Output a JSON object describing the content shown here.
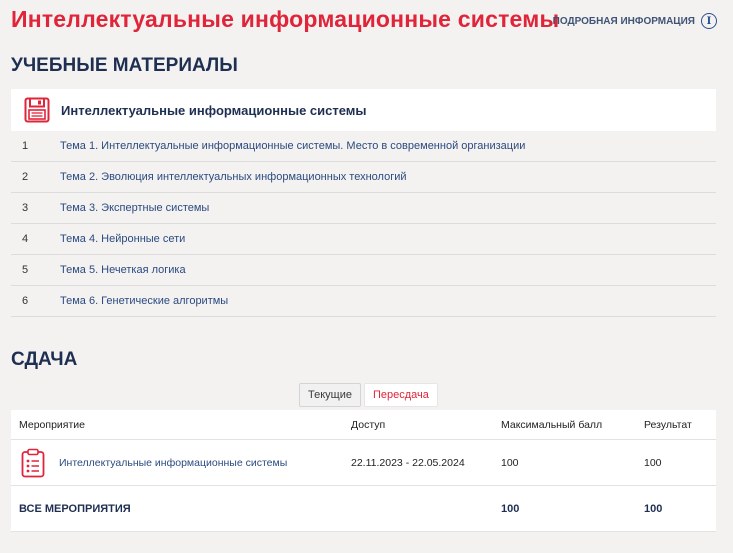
{
  "header": {
    "title": "Интеллектуальные информационные системы",
    "info_label": "ПОДРОБНАЯ ИНФОРМАЦИЯ",
    "info_glyph": "i"
  },
  "materials": {
    "section_title": "УЧЕБНЫЕ МАТЕРИАЛЫ",
    "card_title": "Интеллектуальные информационные системы",
    "items": [
      {
        "num": "1",
        "label": "Тема 1. Интеллектуальные информационные системы. Место в современной организации"
      },
      {
        "num": "2",
        "label": "Тема 2. Эволюция интеллектуальных информационных технологий"
      },
      {
        "num": "3",
        "label": "Тема 3. Экспертные системы"
      },
      {
        "num": "4",
        "label": "Тема 4. Нейронные сети"
      },
      {
        "num": "5",
        "label": "Тема 5. Нечеткая логика"
      },
      {
        "num": "6",
        "label": "Тема 6. Генетические алгоритмы"
      }
    ]
  },
  "exam": {
    "section_title": "СДАЧА",
    "tabs": [
      {
        "label": "Текущие"
      },
      {
        "label": "Пересдача"
      }
    ],
    "columns": [
      "Мероприятие",
      "Доступ",
      "Максимальный балл",
      "Результат"
    ],
    "rows": [
      {
        "event": "Интеллектуальные информационные системы",
        "access": "22.11.2023 - 22.05.2024",
        "max": "100",
        "result": "100"
      }
    ],
    "total": {
      "label": "ВСЕ МЕРОПРИЯТИЯ",
      "max": "100",
      "result": "100"
    }
  },
  "colors": {
    "accent": "#e0243a",
    "navy": "#1f2f52",
    "link": "#2b4a80",
    "background": "#f3f2f0"
  },
  "icons": {
    "info": "info-circle-icon",
    "materials": "floppy-disk-icon",
    "event": "clipboard-list-icon"
  }
}
